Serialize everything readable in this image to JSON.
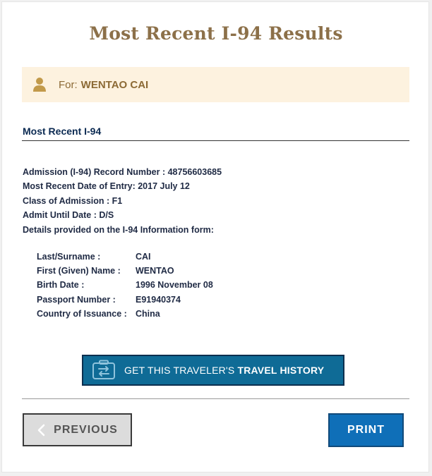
{
  "page": {
    "title": "Most Recent I-94 Results"
  },
  "traveler": {
    "for_label": "For:",
    "name": "WENTAO CAI"
  },
  "section": {
    "title": "Most Recent I-94"
  },
  "record": {
    "admission_number": "Admission (I-94) Record Number : 48756603685",
    "entry_date": "Most Recent Date of Entry: 2017 July 12",
    "class_of_admission": "Class of Admission : F1",
    "admit_until": "Admit Until Date : D/S",
    "details_intro": "Details provided on the I-94 Information form:"
  },
  "details": [
    {
      "label": "Last/Surname :",
      "value": "CAI"
    },
    {
      "label": "First (Given) Name :",
      "value": "WENTAO"
    },
    {
      "label": "Birth Date :",
      "value": "1996 November 08"
    },
    {
      "label": "Passport Number :",
      "value": "E91940374"
    },
    {
      "label": "Country of Issuance :",
      "value": "China"
    }
  ],
  "buttons": {
    "travel_history_prefix": "GET THIS TRAVELER'S",
    "travel_history_bold": "TRAVEL HISTORY",
    "previous": "PREVIOUS",
    "print": "PRINT"
  },
  "icons": {
    "user": "user-icon",
    "travel": "travel-history-icon",
    "previous": "chevron-left-icon"
  },
  "colors": {
    "title": "#8c7049",
    "for_box_bg": "#fdf2df",
    "travel_button": "#0f6b96",
    "print_button": "#0f6fb8",
    "previous_button": "#dcdcdc"
  }
}
